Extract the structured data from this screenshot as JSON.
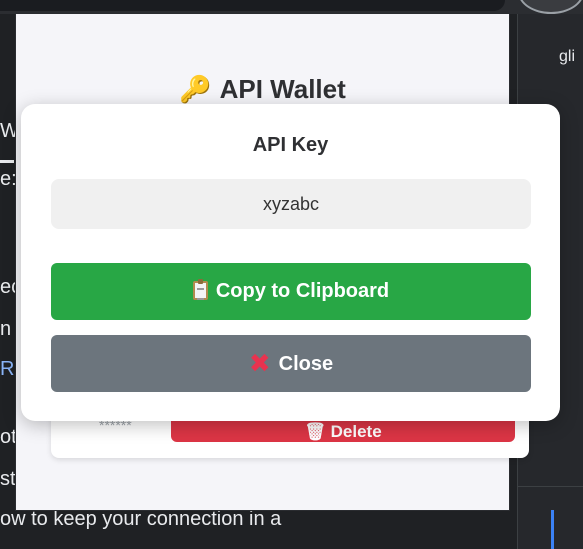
{
  "background": {
    "left_lines": [
      "We",
      "e:",
      "ec",
      " n",
      "Re",
      "ot",
      "st"
    ],
    "bottom_line": "ow to keep your connection in a",
    "right_text": "gli"
  },
  "popup": {
    "title": "API Wallet",
    "title_icon": "key-icon",
    "under_card": {
      "masked_key": "******",
      "delete_label": "🗑 Delete"
    }
  },
  "modal": {
    "title": "API Key",
    "key_value": "xyzabc",
    "copy_button": {
      "label": "Copy to Clipboard",
      "icon": "clipboard-icon"
    },
    "close_button": {
      "label": "Close",
      "icon": "close-icon"
    },
    "colors": {
      "copy": "#28a745",
      "close": "#6c757d",
      "delete": "#dc3545"
    }
  }
}
